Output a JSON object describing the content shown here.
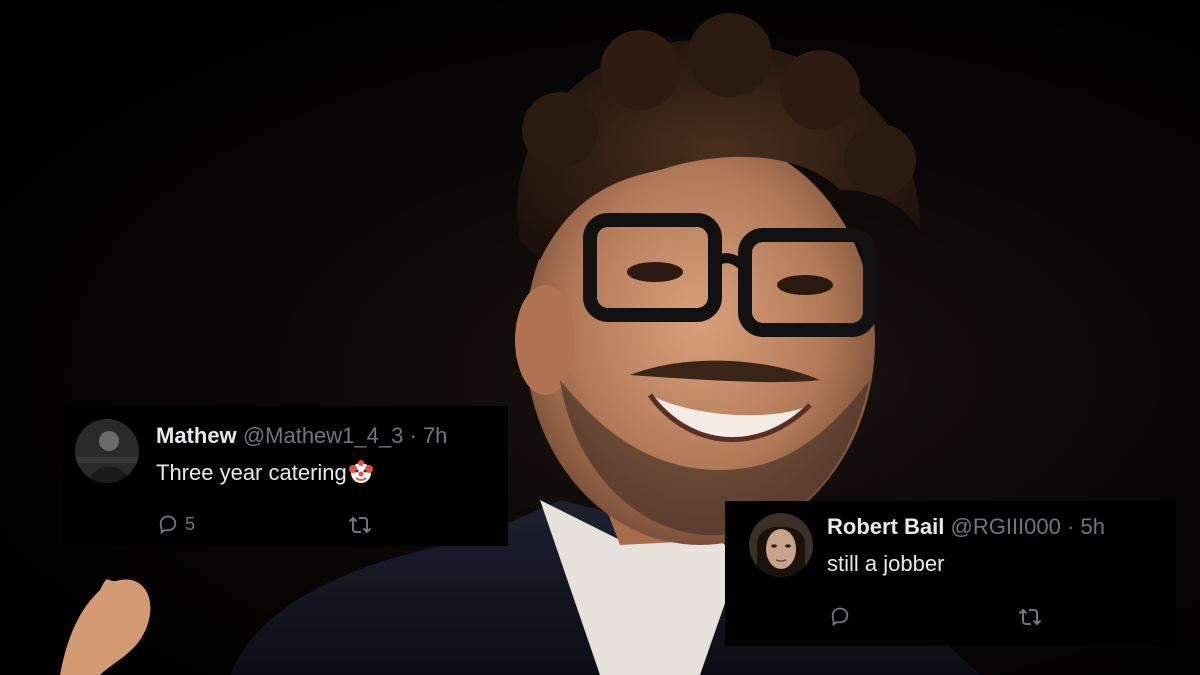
{
  "tweets": [
    {
      "display_name": "Mathew",
      "handle": "@Mathew1_4_3",
      "separator": "·",
      "time": "7h",
      "text": "Three year catering",
      "emoji": "clown-face-icon",
      "reply_count": "5"
    },
    {
      "display_name": "Robert Bail",
      "handle": "@RGIII000",
      "separator": "·",
      "time": "5h",
      "text": "still a jobber"
    }
  ],
  "colors": {
    "card_background": "#000000",
    "primary_text": "#e7e9ea",
    "secondary_text": "#71767b"
  }
}
